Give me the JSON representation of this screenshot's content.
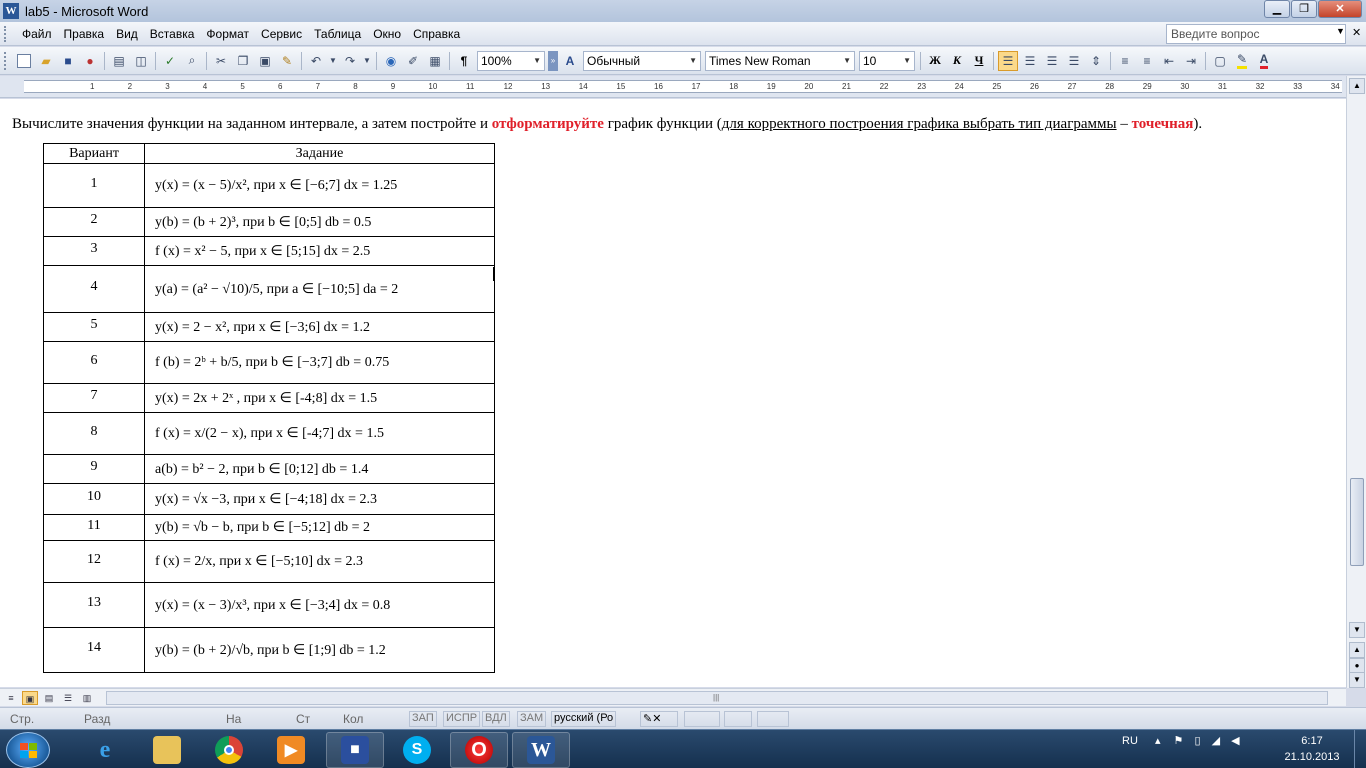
{
  "window": {
    "title": "lab5 - Microsoft Word"
  },
  "menu": {
    "items": [
      "Файл",
      "Правка",
      "Вид",
      "Вставка",
      "Формат",
      "Сервис",
      "Таблица",
      "Окно",
      "Справка"
    ],
    "ask_placeholder": "Введите вопрос"
  },
  "toolbar": {
    "zoom": "100%",
    "style": "Обычный",
    "font": "Times New Roman",
    "size": "10",
    "bold": "Ж",
    "italic": "К",
    "underline": "Ч"
  },
  "ruler": {
    "ticks": [
      "1",
      "2",
      "3",
      "4",
      "5",
      "6",
      "7",
      "8",
      "9",
      "10",
      "11",
      "12",
      "13",
      "14",
      "15",
      "16",
      "17",
      "18",
      "19",
      "20",
      "21",
      "22",
      "23",
      "24",
      "25",
      "26",
      "27",
      "28",
      "29",
      "30",
      "31",
      "32",
      "33",
      "34"
    ]
  },
  "document": {
    "intro_1": "Вычислите значения функции на заданном интервале, а затем постройте и ",
    "intro_red1": "отформатируйте",
    "intro_2": " график функции (",
    "intro_underline": "для корректного построения графика выбрать тип диаграммы",
    "intro_3": " – ",
    "intro_red2": "точечная",
    "intro_4": ").",
    "table": {
      "headers": [
        "Вариант",
        "Задание"
      ],
      "rows": [
        {
          "n": "1",
          "fn": "y(x) = (x − 5)/x²",
          "cond": ",   при   x ∈ [−6;7]    dx = 1.25"
        },
        {
          "n": "2",
          "fn": "y(b) = (b + 2)³",
          "cond": ",    при    b ∈ [0;5]    db = 0.5"
        },
        {
          "n": "3",
          "fn": "f (x) = x² − 5",
          "cond": ", при   x ∈ [5;15]    dx = 2.5"
        },
        {
          "n": "4",
          "fn": "y(a) = (a² − √10)/5",
          "cond": ",    при    a ∈ [−10;5]    da = 2"
        },
        {
          "n": "5",
          "fn": "y(x) = 2 − x²",
          "cond": ",    при    x ∈ [−3;6]    dx = 1.2"
        },
        {
          "n": "6",
          "fn": "f (b) = 2ᵇ + b/5",
          "cond": ",    при    b ∈ [−3;7]    db = 0.75"
        },
        {
          "n": "7",
          "fn": "y(x) = 2x + 2ˣ",
          "cond": " ,    при    x ∈ [-4;8]    dx = 1.5"
        },
        {
          "n": "8",
          "fn": "f (x) = x/(2 − x)",
          "cond": ",    при    x ∈ [-4;7]    dx = 1.5"
        },
        {
          "n": "9",
          "fn": "a(b) = b² − 2",
          "cond": ",    при    b ∈ [0;12]    db = 1.4"
        },
        {
          "n": "10",
          "fn": "y(x) = √x  −3",
          "cond": ",    при    x ∈ [−4;18]    dx = 2.3"
        },
        {
          "n": "11",
          "fn": "y(b) = √b − b",
          "cond": ",    при    b ∈ [−5;12]    db = 2"
        },
        {
          "n": "12",
          "fn": "f (x) = 2/x",
          "cond": ",    при    x ∈ [−5;10]    dx = 2.3"
        },
        {
          "n": "13",
          "fn": "y(x) = (x − 3)/x³",
          "cond": ",    при    x ∈ [−3;4]    dx = 0.8"
        },
        {
          "n": "14",
          "fn": "y(b) = (b + 2)/√b",
          "cond": ",    при    b ∈ [1;9]    db = 1.2"
        }
      ]
    }
  },
  "statusbar": {
    "page": "Стр.",
    "section": "Разд",
    "at": "На",
    "line": "Ст",
    "col": "Кол",
    "rec": "ЗАП",
    "trk": "ИСПР",
    "ext": "ВДЛ",
    "ovr": "ЗАМ",
    "lang": "русский (Ро"
  },
  "taskbar": {
    "tray_lang": "RU",
    "time": "6:17",
    "date": "21.10.2013"
  }
}
